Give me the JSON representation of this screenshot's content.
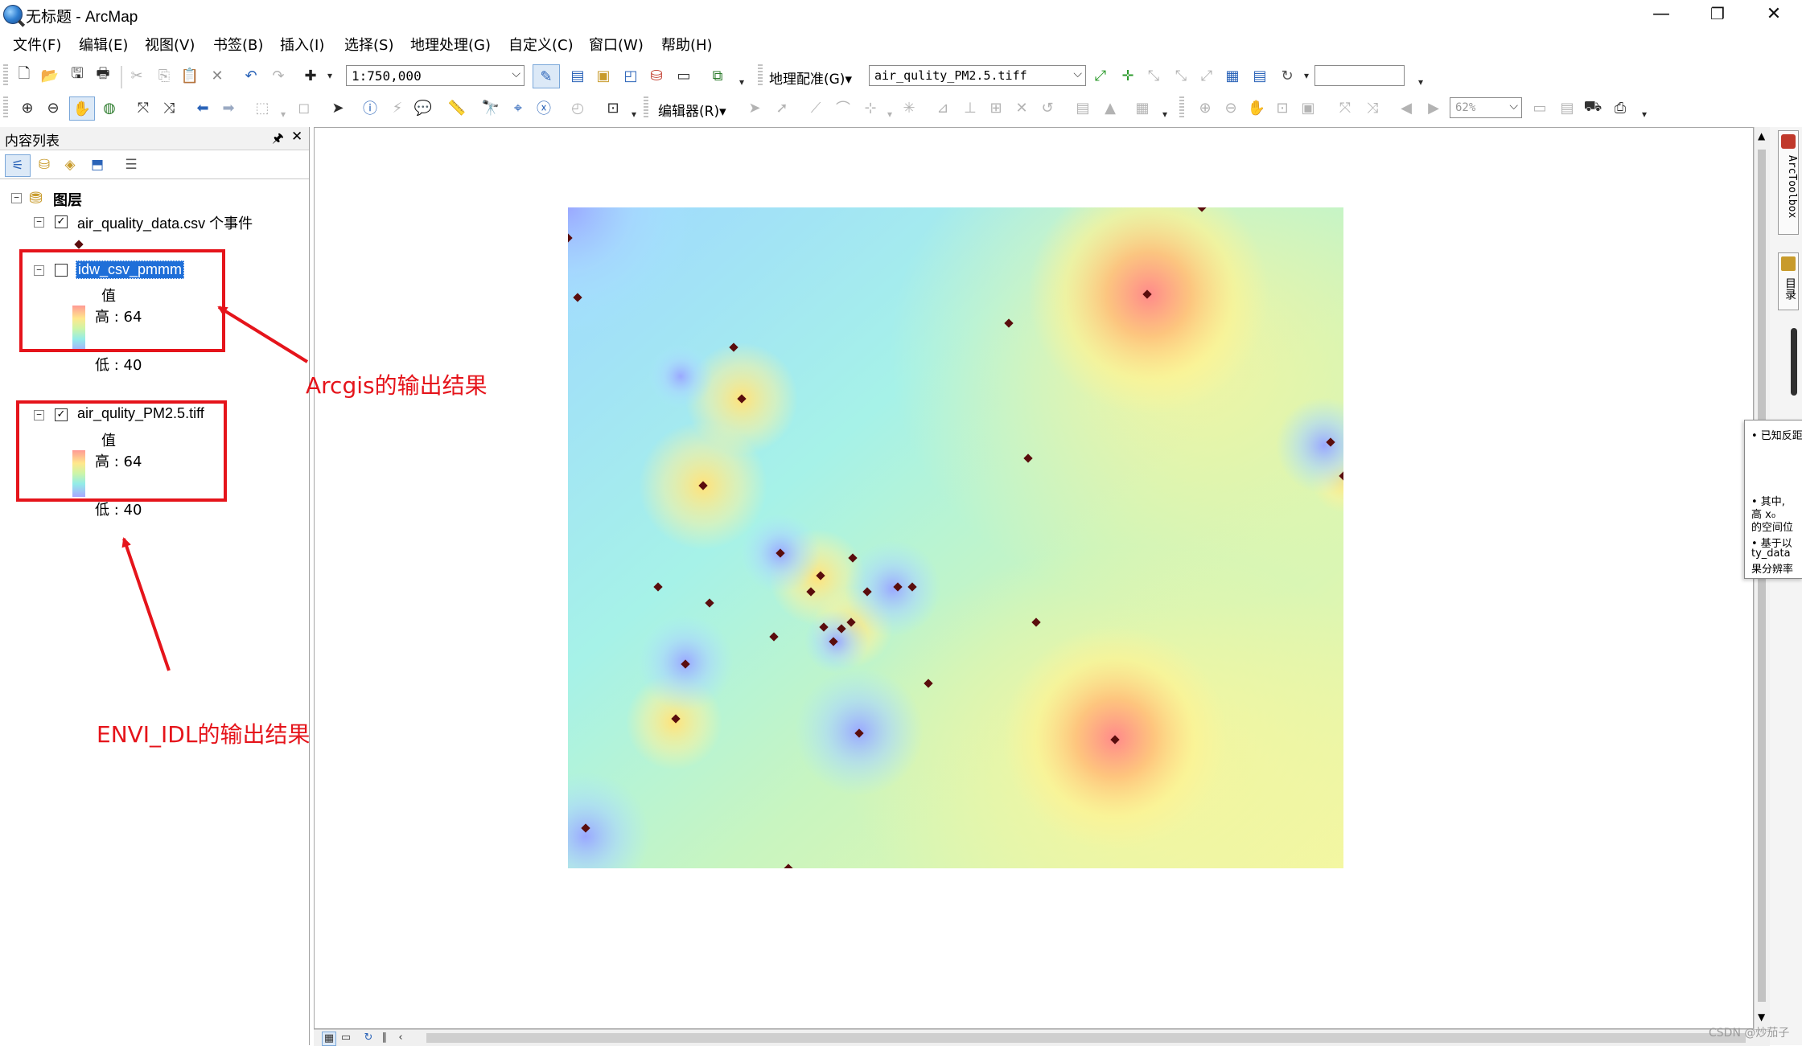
{
  "window": {
    "title": "无标题 - ArcMap",
    "minimize": "—",
    "restore": "❐",
    "close": "✕"
  },
  "menu": [
    {
      "label": "文件(F)"
    },
    {
      "label": "编辑(E)"
    },
    {
      "label": "视图(V)"
    },
    {
      "label": "书签(B)"
    },
    {
      "label": "插入(I)"
    },
    {
      "label": "选择(S)"
    },
    {
      "label": "地理处理(G)"
    },
    {
      "label": "自定义(C)"
    },
    {
      "label": "窗口(W)"
    },
    {
      "label": "帮助(H)"
    }
  ],
  "toolbar": {
    "scale_value": "1:750,000",
    "georef_label": "地理配准(G)",
    "georef_arrow": "▾",
    "georef_layer": "air_qulity_PM2.5.tiff",
    "editor_label": "编辑器(R)",
    "editor_arrow": "▾",
    "zoom_percent": "62%",
    "combo_arrow": "⌵"
  },
  "toc": {
    "title": "内容列表",
    "pin": "ᵖ",
    "close": "✕",
    "root_label": "图层",
    "layers": [
      {
        "name": "air_quality_data.csv 个事件",
        "checked": true
      },
      {
        "name": "idw_csv_pmmm",
        "checked": false,
        "value_label": "值",
        "high_label": "高 : 64",
        "low_label": "低 : 40"
      },
      {
        "name": "air_qulity_PM2.5.tiff",
        "checked": true,
        "value_label": "值",
        "high_label": "高 : 64",
        "low_label": "低 : 40"
      }
    ]
  },
  "annotations": {
    "arcgis_label": "Arcgis的输出结果",
    "envi_label": "ENVI_IDL的输出结果"
  },
  "right_dock": {
    "toolbox_tab": "ArcToolbox",
    "catalog_tab": "目录",
    "popup_line1": "• 已知反距",
    "popup_line2": "• 其中,",
    "popup_line3": "高    x₀",
    "popup_line4": "的空间位",
    "popup_line5": "• 基于以",
    "popup_line6": "ty_data",
    "popup_line7": "果分辨率"
  },
  "watermark": "CSDN @炒茄子",
  "map": {
    "value_high": 64,
    "value_low": 40
  }
}
